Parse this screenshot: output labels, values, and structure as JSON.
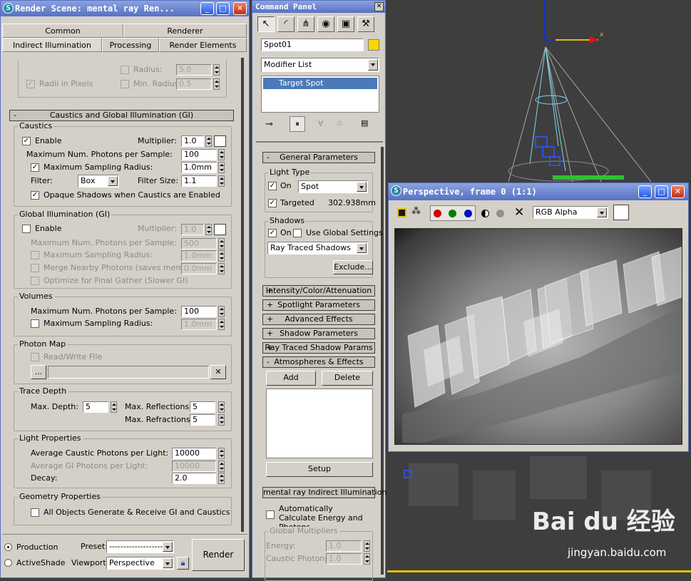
{
  "render_scene": {
    "title": "Render Scene: mental ray Ren...",
    "tabs": [
      "Common",
      "Renderer",
      "Indirect Illumination",
      "Processing",
      "Render Elements"
    ],
    "top": {
      "radius_label": "Radius:",
      "radius_value": "5.0",
      "radii_label": "Radii in Pixels",
      "min_radius_label": "Min. Radius:",
      "min_radius_value": "0.5"
    },
    "rollout_title": "Caustics and Global Illumination (GI)",
    "caustics": {
      "group": "Caustics",
      "enable": "Enable",
      "multiplier_label": "Multiplier:",
      "multiplier": "1.0",
      "max_photons_label": "Maximum Num. Photons per Sample:",
      "max_photons": "100",
      "max_radius_label": "Maximum Sampling Radius:",
      "max_radius": "1.0mm",
      "filter_label": "Filter:",
      "filter": "Box",
      "filter_size_label": "Filter Size:",
      "filter_size": "1.1",
      "opaque_label": "Opaque Shadows when Caustics are Enabled"
    },
    "gi": {
      "group": "Global Illumination (GI)",
      "enable": "Enable",
      "multiplier_label": "Multiplier:",
      "multiplier": "1.0",
      "max_photons_label": "Maximum Num. Photons per Sample:",
      "max_photons": "500",
      "max_radius_label": "Maximum Sampling Radius:",
      "max_radius": "1.0mm",
      "merge_label": "Merge Nearby Photons (saves memory):",
      "merge": "0.0mm",
      "optimize_label": "Optimize for Final Gather (Slower GI)"
    },
    "volumes": {
      "group": "Volumes",
      "max_photons_label": "Maximum Num. Photons per Sample:",
      "max_photons": "100",
      "max_radius_label": "Maximum Sampling Radius:",
      "max_radius": "1.0mm"
    },
    "photon_map": {
      "group": "Photon Map",
      "rw_label": "Read/Write File",
      "browse": "..."
    },
    "trace_depth": {
      "group": "Trace Depth",
      "max_depth_label": "Max. Depth:",
      "max_depth": "5",
      "reflections_label": "Max. Reflections:",
      "reflections": "5",
      "refractions_label": "Max. Refractions:",
      "refractions": "5"
    },
    "light_props": {
      "group": "Light Properties",
      "caustic_label": "Average Caustic Photons per Light:",
      "caustic": "10000",
      "gi_label": "Average GI Photons per Light:",
      "gi": "10000",
      "decay_label": "Decay:",
      "decay": "2.0"
    },
    "geometry": {
      "group": "Geometry Properties",
      "all_label": "All Objects Generate & Receive GI and Caustics"
    },
    "footer": {
      "production": "Production",
      "activeshade": "ActiveShade",
      "preset_label": "Preset:",
      "preset": "--------------------",
      "viewport_label": "Viewport:",
      "viewport": "Perspective",
      "render": "Render"
    }
  },
  "command_panel": {
    "title": "Command Panel",
    "object_name": "Spot01",
    "object_color": "#ffd600",
    "modifier_list": "Modifier List",
    "stack_item": "Target Spot",
    "general": {
      "title": "General Parameters",
      "light_type_group": "Light Type",
      "on": "On",
      "type": "Spot",
      "targeted": "Targeted",
      "distance": "302.938mm",
      "shadows_group": "Shadows",
      "shadow_on": "On",
      "global_settings": "Use Global Settings",
      "shadow_type": "Ray Traced Shadows",
      "exclude": "Exclude..."
    },
    "rollouts": [
      "Intensity/Color/Attenuation",
      "Spotlight Parameters",
      "Advanced Effects",
      "Shadow Parameters",
      "Ray Traced Shadow Params"
    ],
    "atmos": {
      "title": "Atmospheres & Effects",
      "add": "Add",
      "delete": "Delete",
      "setup": "Setup"
    },
    "mr_indirect": {
      "title": "mental ray Indirect Illumination",
      "auto_label": "Automatically Calculate Energy and Photons",
      "global_group": "Global Multipliers",
      "energy_label": "Energy:",
      "energy": "1.0",
      "caustic_label": "Caustic Photons:",
      "caustic": "1.0"
    }
  },
  "frame_window": {
    "title": "Perspective, frame 0 (1:1)",
    "channel": "RGB Alpha"
  },
  "viewport": {
    "axis_label": "x"
  },
  "watermark": {
    "text": "Bai du 经验",
    "url": "jingyan.baidu.com"
  },
  "colors": {
    "titlebar": "#5670c4",
    "panel": "#d4d0c8",
    "selection": "#4a7ab8"
  }
}
